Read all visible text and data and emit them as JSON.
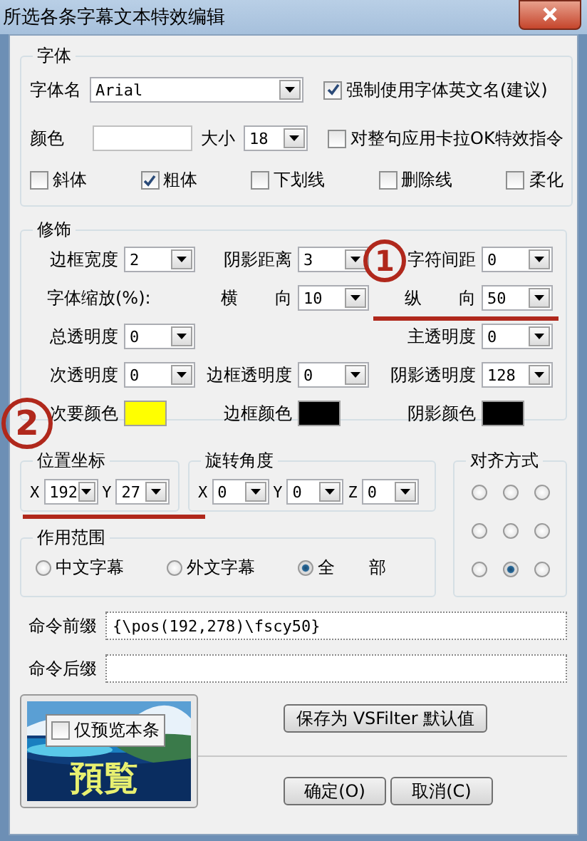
{
  "window": {
    "title": "所选各条字幕文本特效编辑"
  },
  "font": {
    "title": "字体",
    "name_label": "字体名",
    "name_value": "Arial",
    "force_english": {
      "label": "强制使用字体英文名(建议)",
      "checked": true
    },
    "color_label": "颜色",
    "color": "#ffffff",
    "size_label": "大小",
    "size_value": "18",
    "karaoke": {
      "label": "对整句应用卡拉OK特效指令",
      "checked": false
    },
    "styles": [
      {
        "label": "斜体",
        "checked": false
      },
      {
        "label": "粗体",
        "checked": true
      },
      {
        "label": "下划线",
        "checked": false
      },
      {
        "label": "删除线",
        "checked": false
      },
      {
        "label": "柔化",
        "checked": false
      }
    ]
  },
  "decoration": {
    "title": "修饰",
    "rows": [
      [
        {
          "kind": "combo",
          "label": "边框宽度",
          "value": "2"
        },
        {
          "kind": "combo",
          "label": "阴影距离",
          "value": "3"
        },
        {
          "kind": "combo",
          "label": "字符间距",
          "value": "0"
        }
      ],
      [
        {
          "kind": "label",
          "label": "字体缩放(%):"
        },
        {
          "kind": "combo",
          "label": "横 向",
          "value": "10"
        },
        {
          "kind": "combo",
          "label": "纵 向",
          "value": "50"
        }
      ],
      [
        {
          "kind": "combo",
          "label": "总透明度",
          "value": "0"
        },
        "",
        {
          "kind": "combo",
          "label": "主透明度",
          "value": "0"
        }
      ],
      [
        {
          "kind": "combo",
          "label": "次透明度",
          "value": "0"
        },
        {
          "kind": "combo",
          "label": "边框透明度",
          "value": "0"
        },
        {
          "kind": "combo",
          "label": "阴影透明度",
          "value": "128"
        }
      ],
      [
        {
          "kind": "swatch",
          "label": "次要颜色",
          "color": "#ffff00"
        },
        {
          "kind": "swatch",
          "label": "边框颜色",
          "color": "#000000"
        },
        {
          "kind": "swatch",
          "label": "阴影颜色",
          "color": "#000000"
        }
      ]
    ]
  },
  "position": {
    "title": "位置坐标",
    "fields": [
      {
        "label": "X",
        "value": "192"
      },
      {
        "label": "Y",
        "value": "27"
      }
    ]
  },
  "rotation": {
    "title": "旋转角度",
    "fields": [
      {
        "label": "X",
        "value": "0"
      },
      {
        "label": "Y",
        "value": "0"
      },
      {
        "label": "Z",
        "value": "0"
      }
    ]
  },
  "alignment": {
    "title": "对齐方式",
    "options": [
      {
        "selected": false
      },
      {
        "selected": false
      },
      {
        "selected": false
      },
      {
        "selected": false
      },
      {
        "selected": false
      },
      {
        "selected": false
      },
      {
        "selected": false
      },
      {
        "selected": true
      },
      {
        "selected": false
      }
    ]
  },
  "scope": {
    "title": "作用范围",
    "options": [
      {
        "label": "中文字幕",
        "selected": false
      },
      {
        "label": "外文字幕",
        "selected": false
      },
      {
        "label": "全 部",
        "selected": true
      }
    ]
  },
  "commands": [
    {
      "label": "命令前缀",
      "value": "{\\pos(192,278)\\fscy50}"
    },
    {
      "label": "命令后缀"
    }
  ],
  "preview": {
    "checkbox": {
      "label": "仅预览本条",
      "checked": false
    },
    "caption": "預覧"
  },
  "buttons": {
    "save": "保存为 VSFilter 默认值",
    "ok": "确定(O)",
    "cancel": "取消(C)"
  },
  "annotations": [
    {
      "text": "1"
    },
    {
      "text": "2"
    }
  ]
}
